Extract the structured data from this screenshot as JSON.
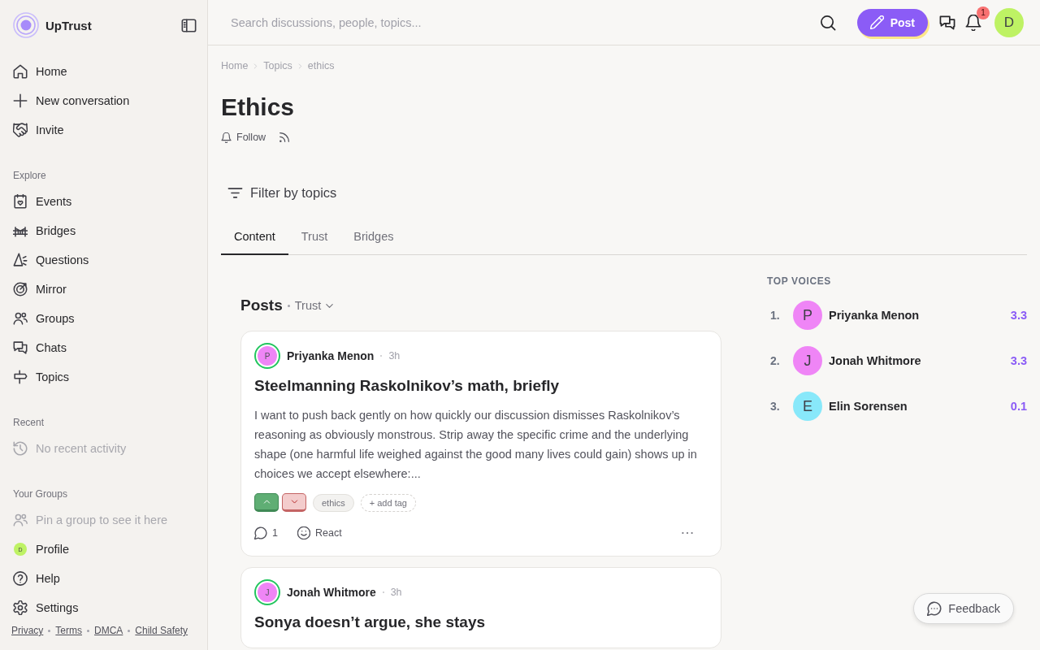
{
  "sidebar": {
    "brand": {
      "name": "UpTrust"
    },
    "sections": [
      {
        "items": [
          {
            "label": "Home",
            "kind": "link",
            "selected": false
          },
          {
            "label": "New conversation",
            "kind": "link",
            "selected": false
          },
          {
            "label": "Invite",
            "kind": "link",
            "selected": false
          }
        ]
      },
      {
        "heading": "Explore",
        "items": [
          {
            "label": "Events",
            "kind": "link",
            "selected": false
          },
          {
            "label": "Bridges",
            "kind": "link",
            "selected": false
          },
          {
            "label": "Questions",
            "kind": "link",
            "selected": false
          },
          {
            "label": "Mirror",
            "kind": "link",
            "selected": false
          },
          {
            "label": "Groups",
            "kind": "link",
            "selected": false
          },
          {
            "label": "Chats",
            "kind": "link",
            "selected": false
          },
          {
            "label": "Topics",
            "kind": "link",
            "selected": false
          }
        ]
      },
      {
        "heading": "Recent",
        "items": [
          {
            "label": "No recent activity",
            "kind": "empty"
          }
        ]
      },
      {
        "heading": "Your Groups",
        "items": [
          {
            "label": "Pin a group to see it here",
            "kind": "empty"
          },
          {
            "label": "Profile",
            "kind": "profile",
            "avatar": "D",
            "selected": false
          },
          {
            "label": "Help",
            "kind": "link",
            "selected": false
          },
          {
            "label": "Settings",
            "kind": "link",
            "selected": false
          }
        ]
      }
    ],
    "footer_links": [
      "Privacy",
      "Terms",
      "DMCA",
      "Child Safety"
    ]
  },
  "header": {
    "search": {
      "placeholder": "Search discussions, people, topics..."
    },
    "post_button": "Post",
    "notification_count": "1",
    "avatar": "D"
  },
  "breadcrumb": [
    "Home",
    "Topics",
    "ethics"
  ],
  "topic": {
    "title": "Ethics",
    "follow_button": "Follow"
  },
  "filter": {
    "label": "Filter by topics"
  },
  "tabs": [
    {
      "label": "Content",
      "selected": true
    },
    {
      "label": "Trust",
      "selected": false
    },
    {
      "label": "Bridges",
      "selected": false
    }
  ],
  "posts": {
    "heading": "Posts",
    "sort": "Trust",
    "items": [
      {
        "author": "Priyanka Menon",
        "initial": "P",
        "color": "#ef85f6",
        "time": "3h",
        "title": "Steelmanning Raskolnikov’s math, briefly",
        "body": "I want to push back gently on how quickly our discussion dismisses Raskolnikov’s reasoning as obviously monstrous. Strip away the specific crime and the underlying shape (one harmful life weighed against the good many lives could gain) shows up in choices we accept elsewhere:...",
        "tags": [
          "ethics"
        ],
        "add_tag": "+ add tag",
        "comments": "1",
        "react": "React"
      },
      {
        "author": "Jonah Whitmore",
        "initial": "J",
        "color": "#ef85f6",
        "time": "3h",
        "title": "Sonya doesn’t argue, she stays"
      }
    ]
  },
  "top_voices": {
    "heading": "TOP VOICES",
    "items": [
      {
        "rank": "1.",
        "initial": "P",
        "name": "Priyanka Menon",
        "score": "3.3",
        "color": "#ef85f6"
      },
      {
        "rank": "2.",
        "initial": "J",
        "name": "Jonah Whitmore",
        "score": "3.3",
        "color": "#ef85f6"
      },
      {
        "rank": "3.",
        "initial": "E",
        "name": "Elin Sorensen",
        "score": "0.1",
        "color": "#88e8fa"
      }
    ]
  },
  "feedback_button": "Feedback"
}
